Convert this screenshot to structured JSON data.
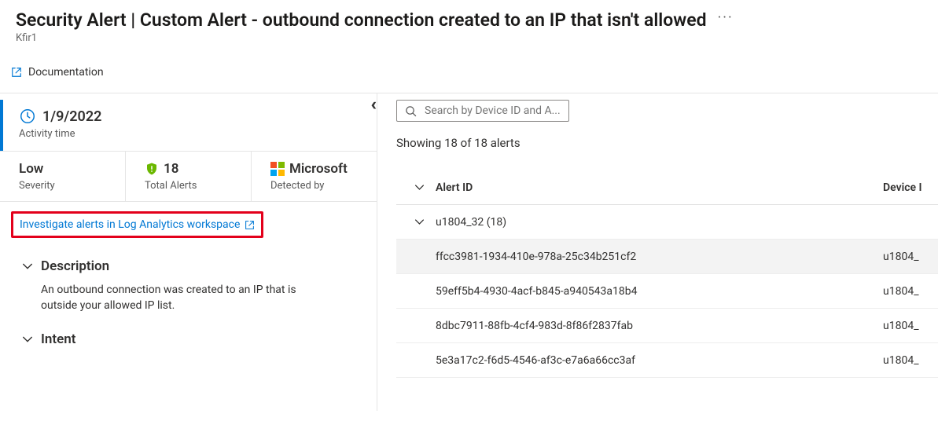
{
  "header": {
    "title": "Security Alert | Custom Alert - outbound connection created to an IP that isn't allowed",
    "subtitle": "Kfir1"
  },
  "toolbar": {
    "documentation": "Documentation"
  },
  "summary": {
    "activity_time_value": "1/9/2022",
    "activity_time_label": "Activity time",
    "severity_value": "Low",
    "severity_label": "Severity",
    "total_alerts_value": "18",
    "total_alerts_label": "Total Alerts",
    "detected_by_value": "Microsoft",
    "detected_by_label": "Detected by"
  },
  "link": {
    "investigate": "Investigate alerts in Log Analytics workspace"
  },
  "sections": {
    "description_title": "Description",
    "description_body": "An outbound connection was created to an IP that is outside your allowed IP list.",
    "intent_title": "Intent"
  },
  "right": {
    "search_placeholder": "Search by Device ID and A...",
    "result_count": "Showing 18 of 18 alerts",
    "columns": {
      "alert_id": "Alert ID",
      "device": "Device I"
    },
    "group": {
      "name": "u1804_32 (18)"
    },
    "rows": [
      {
        "alert_id": "ffcc3981-1934-410e-978a-25c34b251cf2",
        "device": "u1804_"
      },
      {
        "alert_id": "59eff5b4-4930-4acf-b845-a940543a18b4",
        "device": "u1804_"
      },
      {
        "alert_id": "8dbc7911-88fb-4cf4-983d-8f86f2837fab",
        "device": "u1804_"
      },
      {
        "alert_id": "5e3a17c2-f6d5-4546-af3c-e7a6a66cc3af",
        "device": "u1804_"
      }
    ]
  }
}
